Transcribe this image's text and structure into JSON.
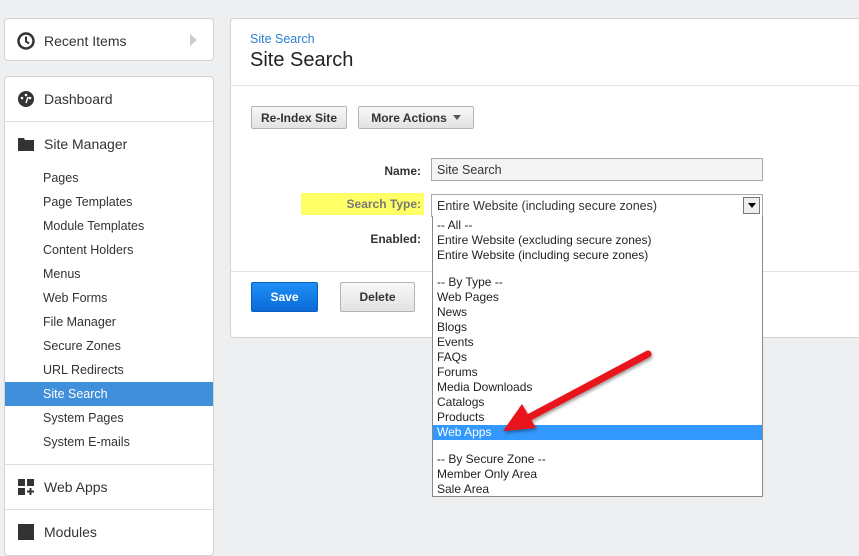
{
  "sidebar": {
    "recent": "Recent Items",
    "dashboard": "Dashboard",
    "site_manager": "Site Manager",
    "items": [
      "Pages",
      "Page Templates",
      "Module Templates",
      "Content Holders",
      "Menus",
      "Web Forms",
      "File Manager",
      "Secure Zones",
      "URL Redirects",
      "Site Search",
      "System Pages",
      "System E-mails"
    ],
    "active": "Site Search",
    "web_apps": "Web Apps",
    "modules": "Modules"
  },
  "main": {
    "breadcrumb": "Site Search",
    "title": "Site Search",
    "reindex": "Re-Index Site",
    "more_actions": "More Actions",
    "name_label": "Name:",
    "name_value": "Site Search",
    "search_type_label": "Search Type:",
    "search_type_value": "Entire Website (including secure zones)",
    "enabled_label": "Enabled:",
    "save": "Save",
    "delete": "Delete"
  },
  "dropdown": {
    "options": [
      "-- All --",
      "Entire Website (excluding secure zones)",
      "Entire Website (including secure zones)",
      "",
      "-- By Type --",
      "Web Pages",
      "News",
      "Blogs",
      "Events",
      "FAQs",
      "Forums",
      "Media Downloads",
      "Catalogs",
      "Products",
      "Web Apps",
      "",
      "-- By Secure Zone --",
      "Member Only Area",
      "Sale Area"
    ],
    "highlighted": "Web Apps"
  },
  "colors": {
    "accent": "#3f8fdb",
    "highlight": "#ffff66",
    "arrow": "#e8141b"
  }
}
